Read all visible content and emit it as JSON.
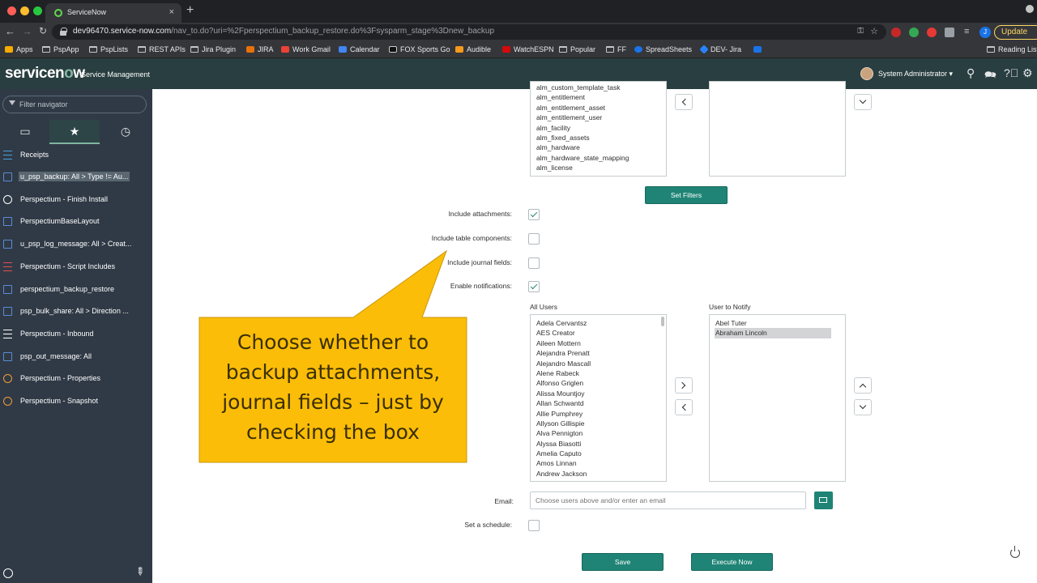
{
  "browser": {
    "tab_title": "ServiceNow",
    "url_host": "dev96470.service-now.com",
    "url_path": "/nav_to.do?uri=%2Fperspectium_backup_restore.do%3Fsysparm_stage%3Dnew_backup",
    "update_label": "Update",
    "profile_initial": "J",
    "bookmarks": [
      "Apps",
      "PspApp",
      "PspLists",
      "REST APIs",
      "Jira Plugin",
      "JIRA",
      "Work Gmail",
      "Calendar",
      "FOX Sports Go",
      "Audible",
      "WatchESPN",
      "Popular",
      "FF",
      "SpreadSheets",
      "DEV- Jira"
    ],
    "reading_list": "Reading List"
  },
  "header": {
    "logo": "servicenow",
    "subtitle": "Service Management",
    "user_name": "System Administrator"
  },
  "sidebar": {
    "filter_placeholder": "Filter navigator",
    "items": [
      {
        "label": "Receipts",
        "icon": "list-icon"
      },
      {
        "label": "u_psp_backup: All > Type != Au...",
        "icon": "document-icon"
      },
      {
        "label": "Perspectium - Finish Install",
        "icon": "info-icon"
      },
      {
        "label": "PerspectiumBaseLayout",
        "icon": "document-icon"
      },
      {
        "label": "u_psp_log_message: All > Creat...",
        "icon": "document-icon"
      },
      {
        "label": "Perspectium - Script Includes",
        "icon": "list-icon"
      },
      {
        "label": "perspectium_backup_restore",
        "icon": "document-icon"
      },
      {
        "label": "psp_bulk_share: All > Direction ...",
        "icon": "document-icon"
      },
      {
        "label": "Perspectium - Inbound",
        "icon": "bulleted-list-icon"
      },
      {
        "label": "psp_out_message: All",
        "icon": "document-icon"
      },
      {
        "label": "Perspectium - Properties",
        "icon": "info-icon"
      },
      {
        "label": "Perspectium - Snapshot",
        "icon": "info-icon"
      }
    ]
  },
  "tables": {
    "available": [
      "alm_custom_template_task",
      "alm_entitlement",
      "alm_entitlement_asset",
      "alm_entitlement_user",
      "alm_facility",
      "alm_fixed_assets",
      "alm_hardware",
      "alm_hardware_state_mapping",
      "alm_license"
    ],
    "set_filters_label": "Set Filters"
  },
  "options": {
    "include_attachments": {
      "label": "Include attachments:",
      "checked": true
    },
    "include_table_components": {
      "label": "Include table components:",
      "checked": false
    },
    "include_journal_fields": {
      "label": "Include journal fields:",
      "checked": false
    },
    "enable_notifications": {
      "label": "Enable notifications:",
      "checked": true
    }
  },
  "users": {
    "all_label": "All Users",
    "notify_label": "User to Notify",
    "all": [
      "Adela Cervantsz",
      "AES Creator",
      "Aileen Mottern",
      "Alejandra Prenatt",
      "Alejandro Mascall",
      "Alene Rabeck",
      "Alfonso Griglen",
      "Alissa Mountjoy",
      "Allan Schwantd",
      "Allie Pumphrey",
      "Allyson Gillispie",
      "Alva Pennigton",
      "Alyssa Biasotti",
      "Amelia Caputo",
      "Amos Linnan",
      "Andrew Jackson"
    ],
    "notify": [
      "Abel Tuter",
      "Abraham Lincoln"
    ],
    "notify_selected": "Abraham Lincoln"
  },
  "email": {
    "label": "Email:",
    "placeholder": "Choose users above and/or enter an email"
  },
  "schedule": {
    "label": "Set a schedule:",
    "checked": false
  },
  "actions": {
    "save_label": "Save",
    "execute_label": "Execute Now"
  },
  "callout": {
    "lines": [
      "Choose whether to",
      "backup attachments,",
      "journal fields – just by",
      "checking the box"
    ]
  },
  "colors": {
    "accent": "#1f8476",
    "header_bg": "#293e40",
    "sidebar_bg": "#303a46",
    "callout_fill": "#fbbd08"
  }
}
